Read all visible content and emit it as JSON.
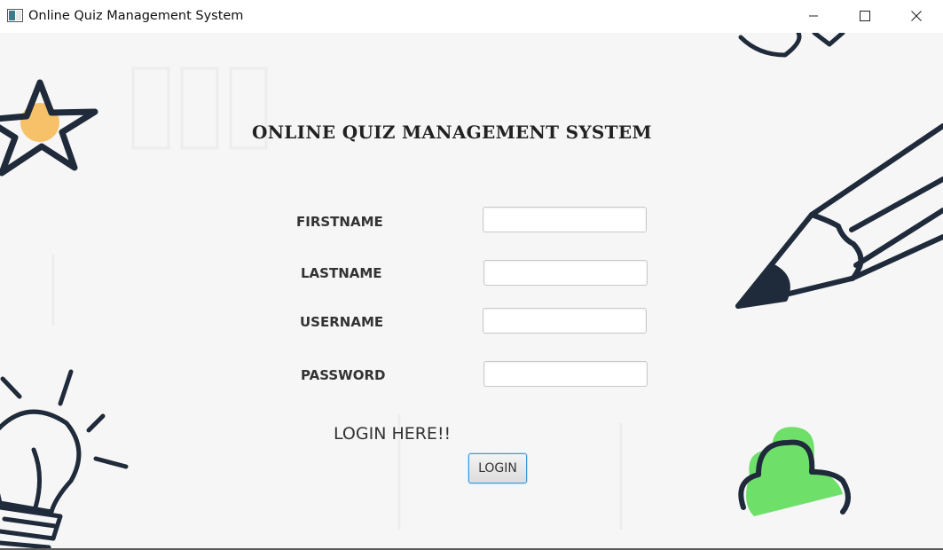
{
  "window": {
    "title": "Online Quiz Management System",
    "icons": [
      "app-icon",
      "minimize-icon",
      "maximize-icon",
      "close-icon"
    ]
  },
  "form": {
    "heading": "ONLINE QUIZ MANAGEMENT SYSTEM",
    "fields": [
      {
        "label": "FIRSTNAME",
        "value": ""
      },
      {
        "label": "LASTNAME",
        "value": ""
      },
      {
        "label": "USERNAME",
        "value": ""
      },
      {
        "label": "PASSWORD",
        "value": ""
      }
    ],
    "login_prompt": "LOGIN HERE!!",
    "login_button": "LOGIN"
  },
  "decorations": [
    "star-doodle",
    "pencil-doodle",
    "lightbulb-doodle",
    "cloud-doodle",
    "heart-doodle"
  ],
  "colors": {
    "background": "#f6f6f6",
    "doodle_stroke": "#1f2a3a",
    "star_fill": "#f7c16a",
    "cloud_fill": "#6ee06a",
    "button_border": "#3a9ad9"
  }
}
